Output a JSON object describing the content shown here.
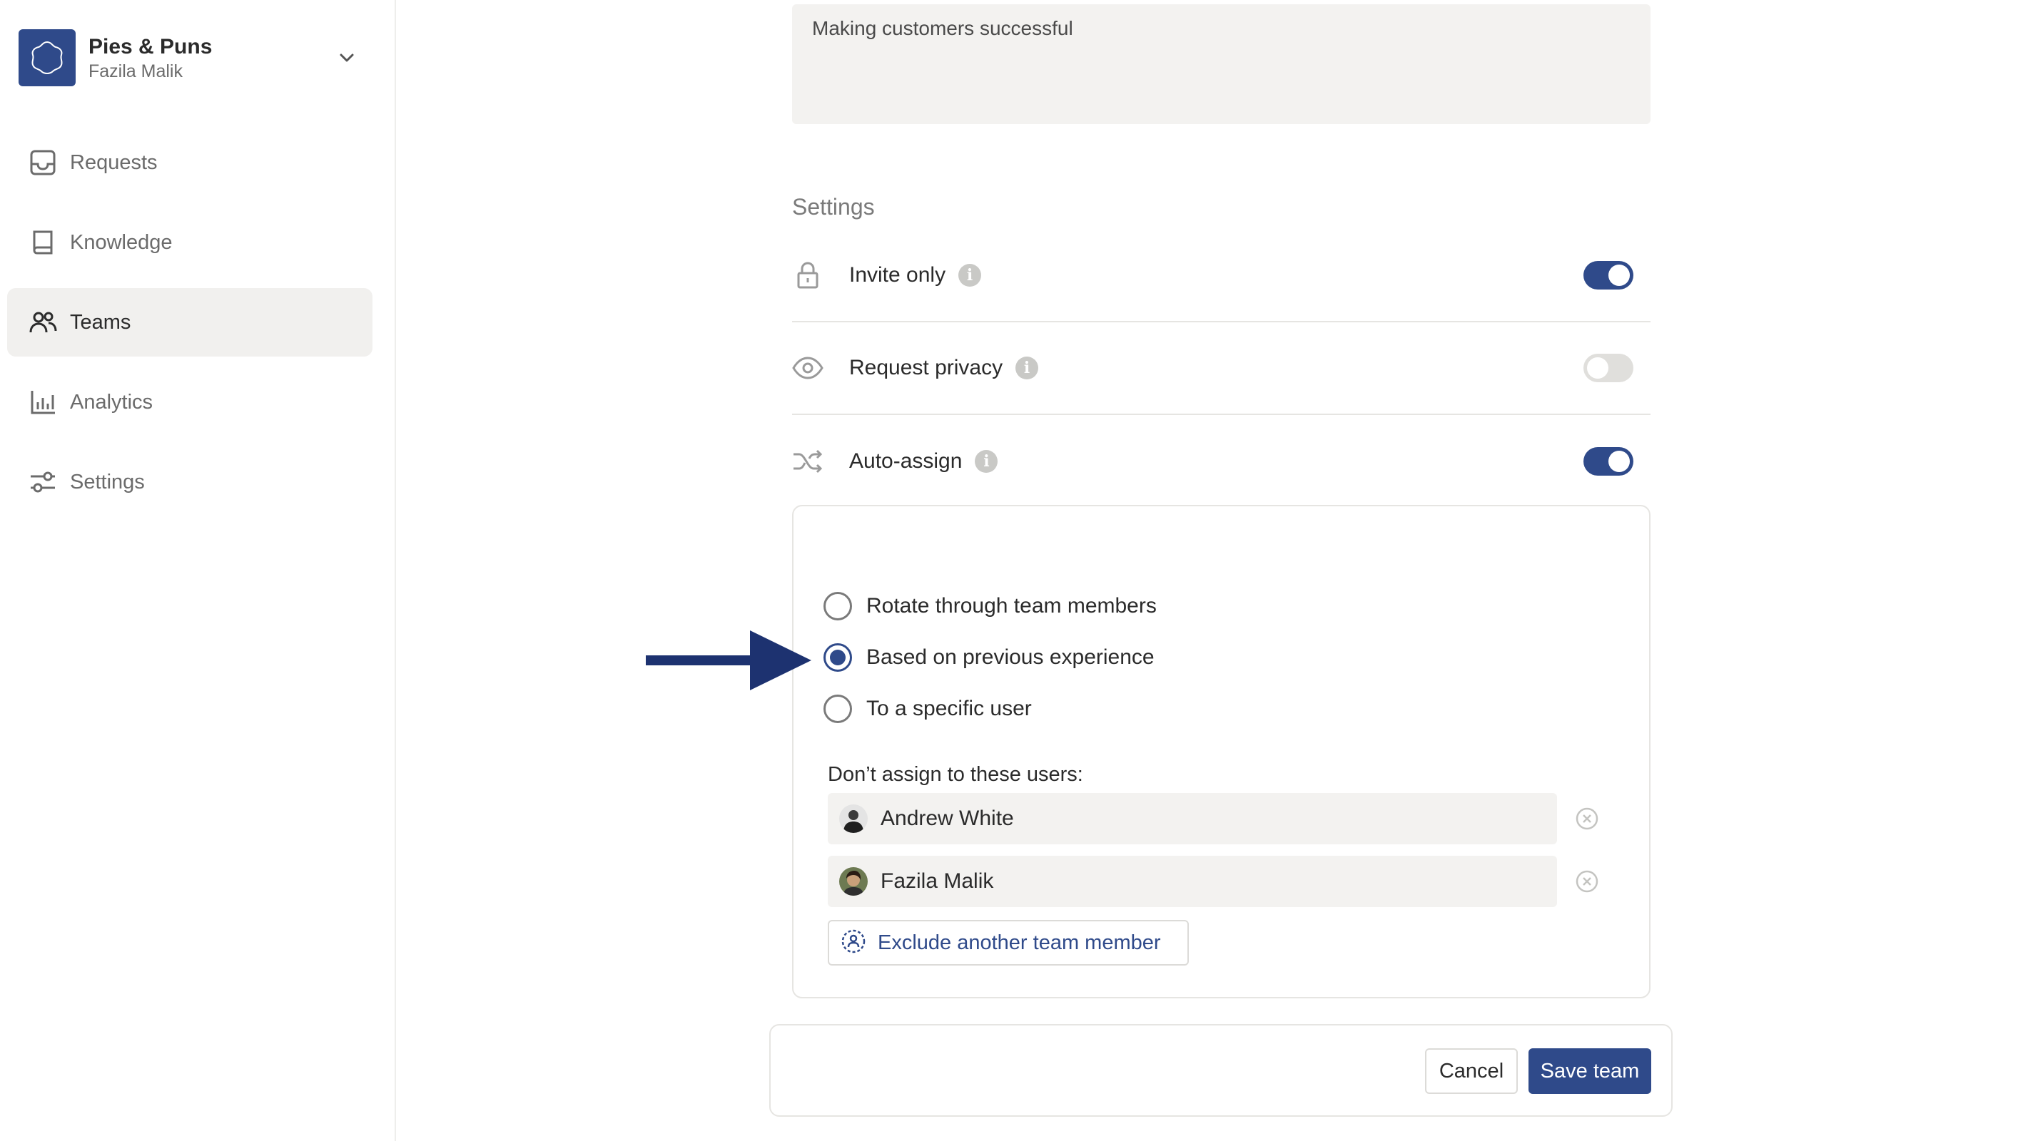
{
  "colors": {
    "accent": "#2f4a8a",
    "arrow": "#1d3270",
    "muted": "#6b6b6b",
    "field_bg": "#f3f2f0"
  },
  "org": {
    "name": "Pies & Puns",
    "user": "Fazila Malik",
    "logo_icon": "flower-icon",
    "menu_icon": "chevron-down-icon"
  },
  "sidebar": {
    "items": [
      {
        "label": "Requests",
        "icon": "inbox-icon",
        "active": false
      },
      {
        "label": "Knowledge",
        "icon": "book-icon",
        "active": false
      },
      {
        "label": "Teams",
        "icon": "people-icon",
        "active": true
      },
      {
        "label": "Analytics",
        "icon": "bar-chart-icon",
        "active": false
      },
      {
        "label": "Settings",
        "icon": "sliders-icon",
        "active": false
      }
    ]
  },
  "description": {
    "value": "Making customers successful"
  },
  "settings": {
    "title": "Settings",
    "rows": [
      {
        "label": "Invite only",
        "icon": "lock-icon",
        "enabled": true
      },
      {
        "label": "Request privacy",
        "icon": "eye-icon",
        "enabled": false
      },
      {
        "label": "Auto-assign",
        "icon": "shuffle-icon",
        "enabled": true
      }
    ],
    "info_glyph": "i"
  },
  "auto_assign": {
    "options": [
      {
        "label": "Rotate through team members",
        "selected": false
      },
      {
        "label": "Based on previous experience",
        "selected": true
      },
      {
        "label": "To a specific user",
        "selected": false
      }
    ],
    "exclude_label": "Don’t assign to these users:",
    "excluded_users": [
      {
        "name": "Andrew White"
      },
      {
        "name": "Fazila Malik"
      }
    ],
    "exclude_button": "Exclude another team member"
  },
  "footer": {
    "cancel": "Cancel",
    "save": "Save team"
  }
}
